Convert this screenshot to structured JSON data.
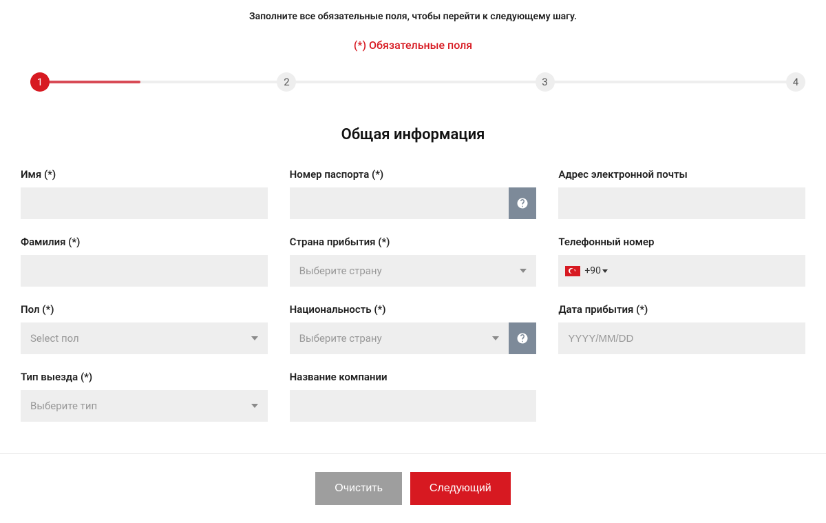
{
  "instruction": "Заполните все обязательные поля, чтобы перейти к следующему шагу.",
  "required_note": "(*) Обязательные поля",
  "stepper": {
    "steps": [
      "1",
      "2",
      "3",
      "4"
    ],
    "active": 1,
    "fill_percent": 14
  },
  "section_title": "Общая информация",
  "fields": {
    "first_name": {
      "label": "Имя (*)"
    },
    "last_name": {
      "label": "Фамилия (*)"
    },
    "gender": {
      "label": "Пол (*)",
      "placeholder": "Select пол"
    },
    "exit_type": {
      "label": "Тип выезда (*)",
      "placeholder": "Выберите тип"
    },
    "passport": {
      "label": "Номер паспорта (*)"
    },
    "arrival_country": {
      "label": "Страна прибытия (*)",
      "placeholder": "Выберите страну"
    },
    "nationality": {
      "label": "Национальность (*)",
      "placeholder": "Выберите страну"
    },
    "company": {
      "label": "Название компании"
    },
    "email": {
      "label": "Адрес электронной почты"
    },
    "phone": {
      "label": "Телефонный номер",
      "dial_code": "+90"
    },
    "arrival_date": {
      "label": "Дата прибытия (*)",
      "placeholder": "YYYY/MM/DD"
    }
  },
  "buttons": {
    "clear": "Очистить",
    "next": "Следующий"
  }
}
